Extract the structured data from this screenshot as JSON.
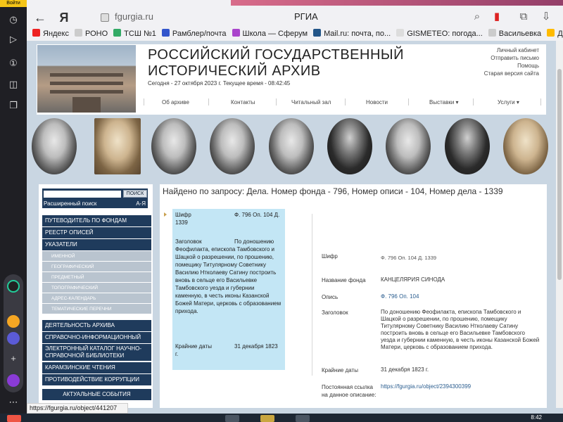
{
  "left_panel": {
    "badge": "Войти"
  },
  "browser": {
    "url": "fgurgia.ru",
    "page_title": "РГИА",
    "bookmarks": [
      {
        "label": "Яндекс",
        "color": "#e22"
      },
      {
        "label": "РОНО",
        "color": "#ccc"
      },
      {
        "label": "ТСШ №1",
        "color": "#3a6"
      },
      {
        "label": "Рамблер/почта",
        "color": "#35c"
      },
      {
        "label": "Школа — Сферум",
        "color": "#a4c"
      },
      {
        "label": "Mail.ru: почта, по...",
        "color": "#258"
      },
      {
        "label": "GISMETEO: погода...",
        "color": "#ddd"
      },
      {
        "label": "Васильевка",
        "color": "#ccc"
      },
      {
        "label": "Днев",
        "color": "#fb0"
      }
    ]
  },
  "header": {
    "title_line1": "РОССИЙСКИЙ ГОСУДАРСТВЕННЫЙ",
    "title_line2": "ИСТОРИЧЕСКИЙ АРХИВ",
    "date_line": "Сегодня - 27 октября 2023 г.   Текущее время - 08:42:45",
    "top_links": [
      "Личный кабинет",
      "Отправить письмо",
      "Помощь",
      "Старая версия сайта"
    ],
    "menu": [
      "Об архиве",
      "Контакты",
      "Читальный зал",
      "Новости",
      "Выставки ▾",
      "Услуги ▾"
    ]
  },
  "sidebar": {
    "search_button": "ПОИСК",
    "advanced_search": "Расширенный поиск",
    "az": "А-Я",
    "items": [
      {
        "label": "ПУТЕВОДИТЕЛЬ ПО ФОНДАМ",
        "style": "dark"
      },
      {
        "label": "РЕЕСТР ОПИСЕЙ",
        "style": "dark"
      },
      {
        "label": "УКАЗАТЕЛИ",
        "style": "dark"
      },
      {
        "label": "ИМЕННОЙ",
        "style": "light"
      },
      {
        "label": "ГЕОГРАФИЧЕСКИЙ",
        "style": "light"
      },
      {
        "label": "ПРЕДМЕТНЫЙ",
        "style": "light"
      },
      {
        "label": "ТОПОГРАФИЧЕСКИЙ",
        "style": "light"
      },
      {
        "label": "АДРЕС-КАЛЕНДАРЬ",
        "style": "light"
      },
      {
        "label": "ТЕМАТИЧЕСКИЕ ПЕРЕЧНИ",
        "style": "light"
      },
      {
        "label": "ДЕЯТЕЛЬНОСТЬ АРХИВА",
        "style": "dark"
      },
      {
        "label": "СПРАВОЧНО-ИНФОРМАЦИОННЫЙ ЦЕНТР",
        "style": "dark"
      },
      {
        "label": "ЭЛЕКТРОННЫЙ КАТАЛОГ НАУЧНО-СПРАВОЧНОЙ БИБЛИОТЕКИ",
        "style": "dark"
      },
      {
        "label": "КАРАМЗИНСКИЕ ЧТЕНИЯ",
        "style": "dark"
      },
      {
        "label": "ПРОТИВОДЕЙСТВИЕ КОРРУПЦИИ",
        "style": "dark"
      }
    ],
    "events": "АКТУАЛЬНЫЕ СОБЫТИЯ"
  },
  "main": {
    "found_title": "Найдено по запросу: Дела. Номер фонда - 796, Номер описи - 104, Номер дела - 1339",
    "card": {
      "shifr_label": "Шифр",
      "shifr_value": "Ф. 796 Оп. 104 Д. 1339",
      "zag_label": "Заголовок",
      "zag_value": "По донош­ению Феофилакта, епископа Тамбовского и Шацкой о разрешении, по прошению, помещику Титулярному Советнику Василию Нтколаеву Сатину построить вновь в сельце его Васильевке Тамбовского уезда и губернии каменную, в честь иконы Казанской Божей Матери, церковь с образованием прихода.",
      "dates_label": "Крайние даты",
      "dates_value": "31 декабря 1823 г."
    },
    "details": {
      "shifr_label": "Шифр",
      "shifr_value": "Ф. 796 Оп. 104 Д. 1339",
      "fond_label": "Название фонда",
      "fond_value": "КАНЦЕЛЯРИЯ СИНОДА",
      "opis_label": "Опись",
      "opis_value": "Ф. 796 Оп. 104",
      "zag_label": "Заголовок",
      "zag_value": "По доношению Феофилакта, епископа Тамбовского и Шацкой о разрешении, по прошению, помещику Титулярному Советнику Василию Нтколаеву Сатину построить вновь в сельце его Васильевке Тамбовского уезда и губернии каменную, в честь иконы Казанской Божей Матери, церковь с образованием прихода.",
      "dates_label": "Крайние даты",
      "dates_value": "31 декабря 1823 г.",
      "link_label": "Постоянная ссылка на данное описание:",
      "link_value": "https://fgurgia.ru/object/2394300399"
    }
  },
  "status_url": "https://fgurgia.ru/object/441207",
  "clock": "8:42"
}
